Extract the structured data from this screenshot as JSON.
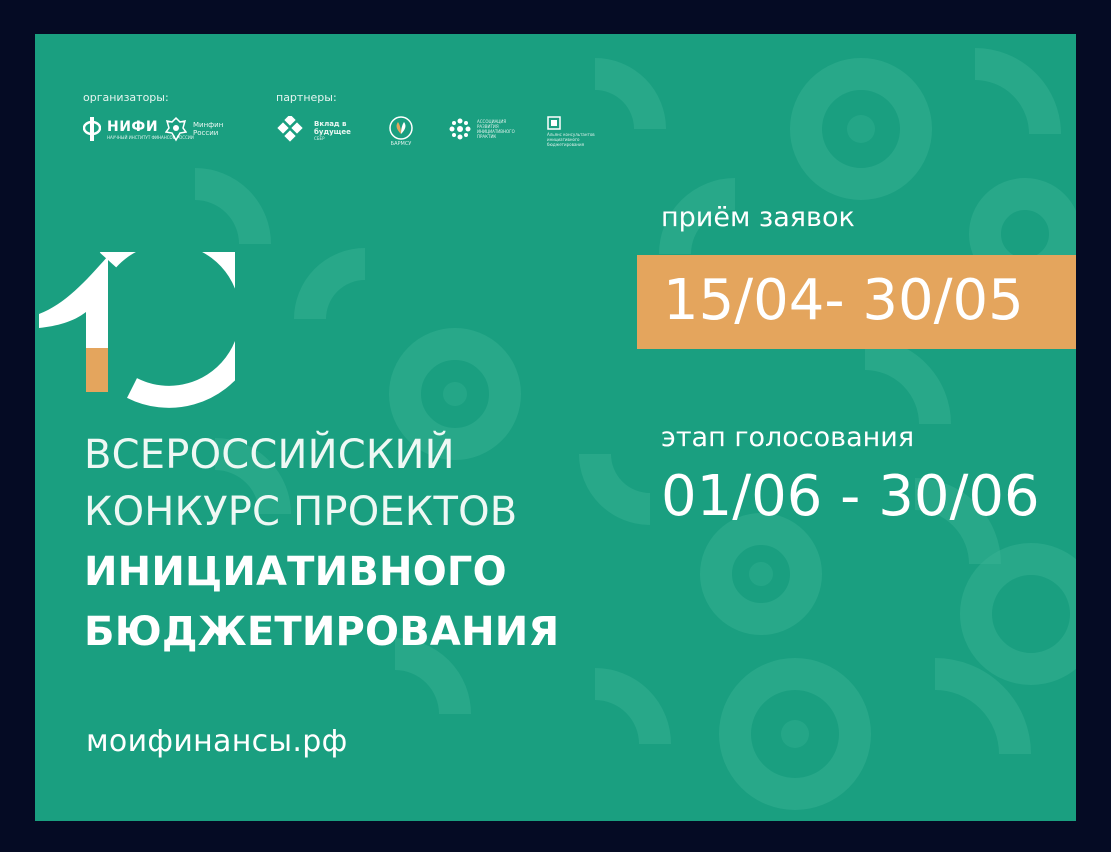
{
  "colors": {
    "frame": "#050b24",
    "banner_bg": "#1a9f80",
    "accent_orange": "#e4a55d",
    "text": "#ffffff"
  },
  "organizers": {
    "label": "организаторы:",
    "logos": [
      {
        "name": "НИФИ",
        "sub": "НАУЧНЫЙ ИНСТИТУТ ФИНАНСОВ РОССИИ",
        "icon": "nifi-logo-icon"
      },
      {
        "name": "Минфин России",
        "icon": "minfin-emblem-icon"
      }
    ]
  },
  "partners": {
    "label": "партнеры:",
    "logos": [
      {
        "name": "Вклад в будущее",
        "sub": "СБЕР",
        "icon": "vklad-logo-icon"
      },
      {
        "name": "БАРМСУ",
        "icon": "barmsu-logo-icon"
      },
      {
        "name": "АССОЦИАЦИЯ РАЗВИТИЯ ИНИЦИАТИВНОГО ПРАКТИК",
        "icon": "association-logo-icon"
      },
      {
        "name": "Альянс консультантов инициативного бюджетирования",
        "icon": "alliance-logo-icon"
      }
    ]
  },
  "title": {
    "line1": "ВСЕРОССИЙСКИЙ",
    "line2": "КОНКУРС ПРОЕКТОВ",
    "line3": "ИНИЦИАТИВНОГО",
    "line4": "БЮДЖЕТИРОВАНИЯ"
  },
  "website": "моифинансы.рф",
  "application": {
    "label": "приём заявок",
    "dates": "15/04- 30/05"
  },
  "voting": {
    "label": "этап голосования",
    "dates": "01/06 - 30/06"
  }
}
